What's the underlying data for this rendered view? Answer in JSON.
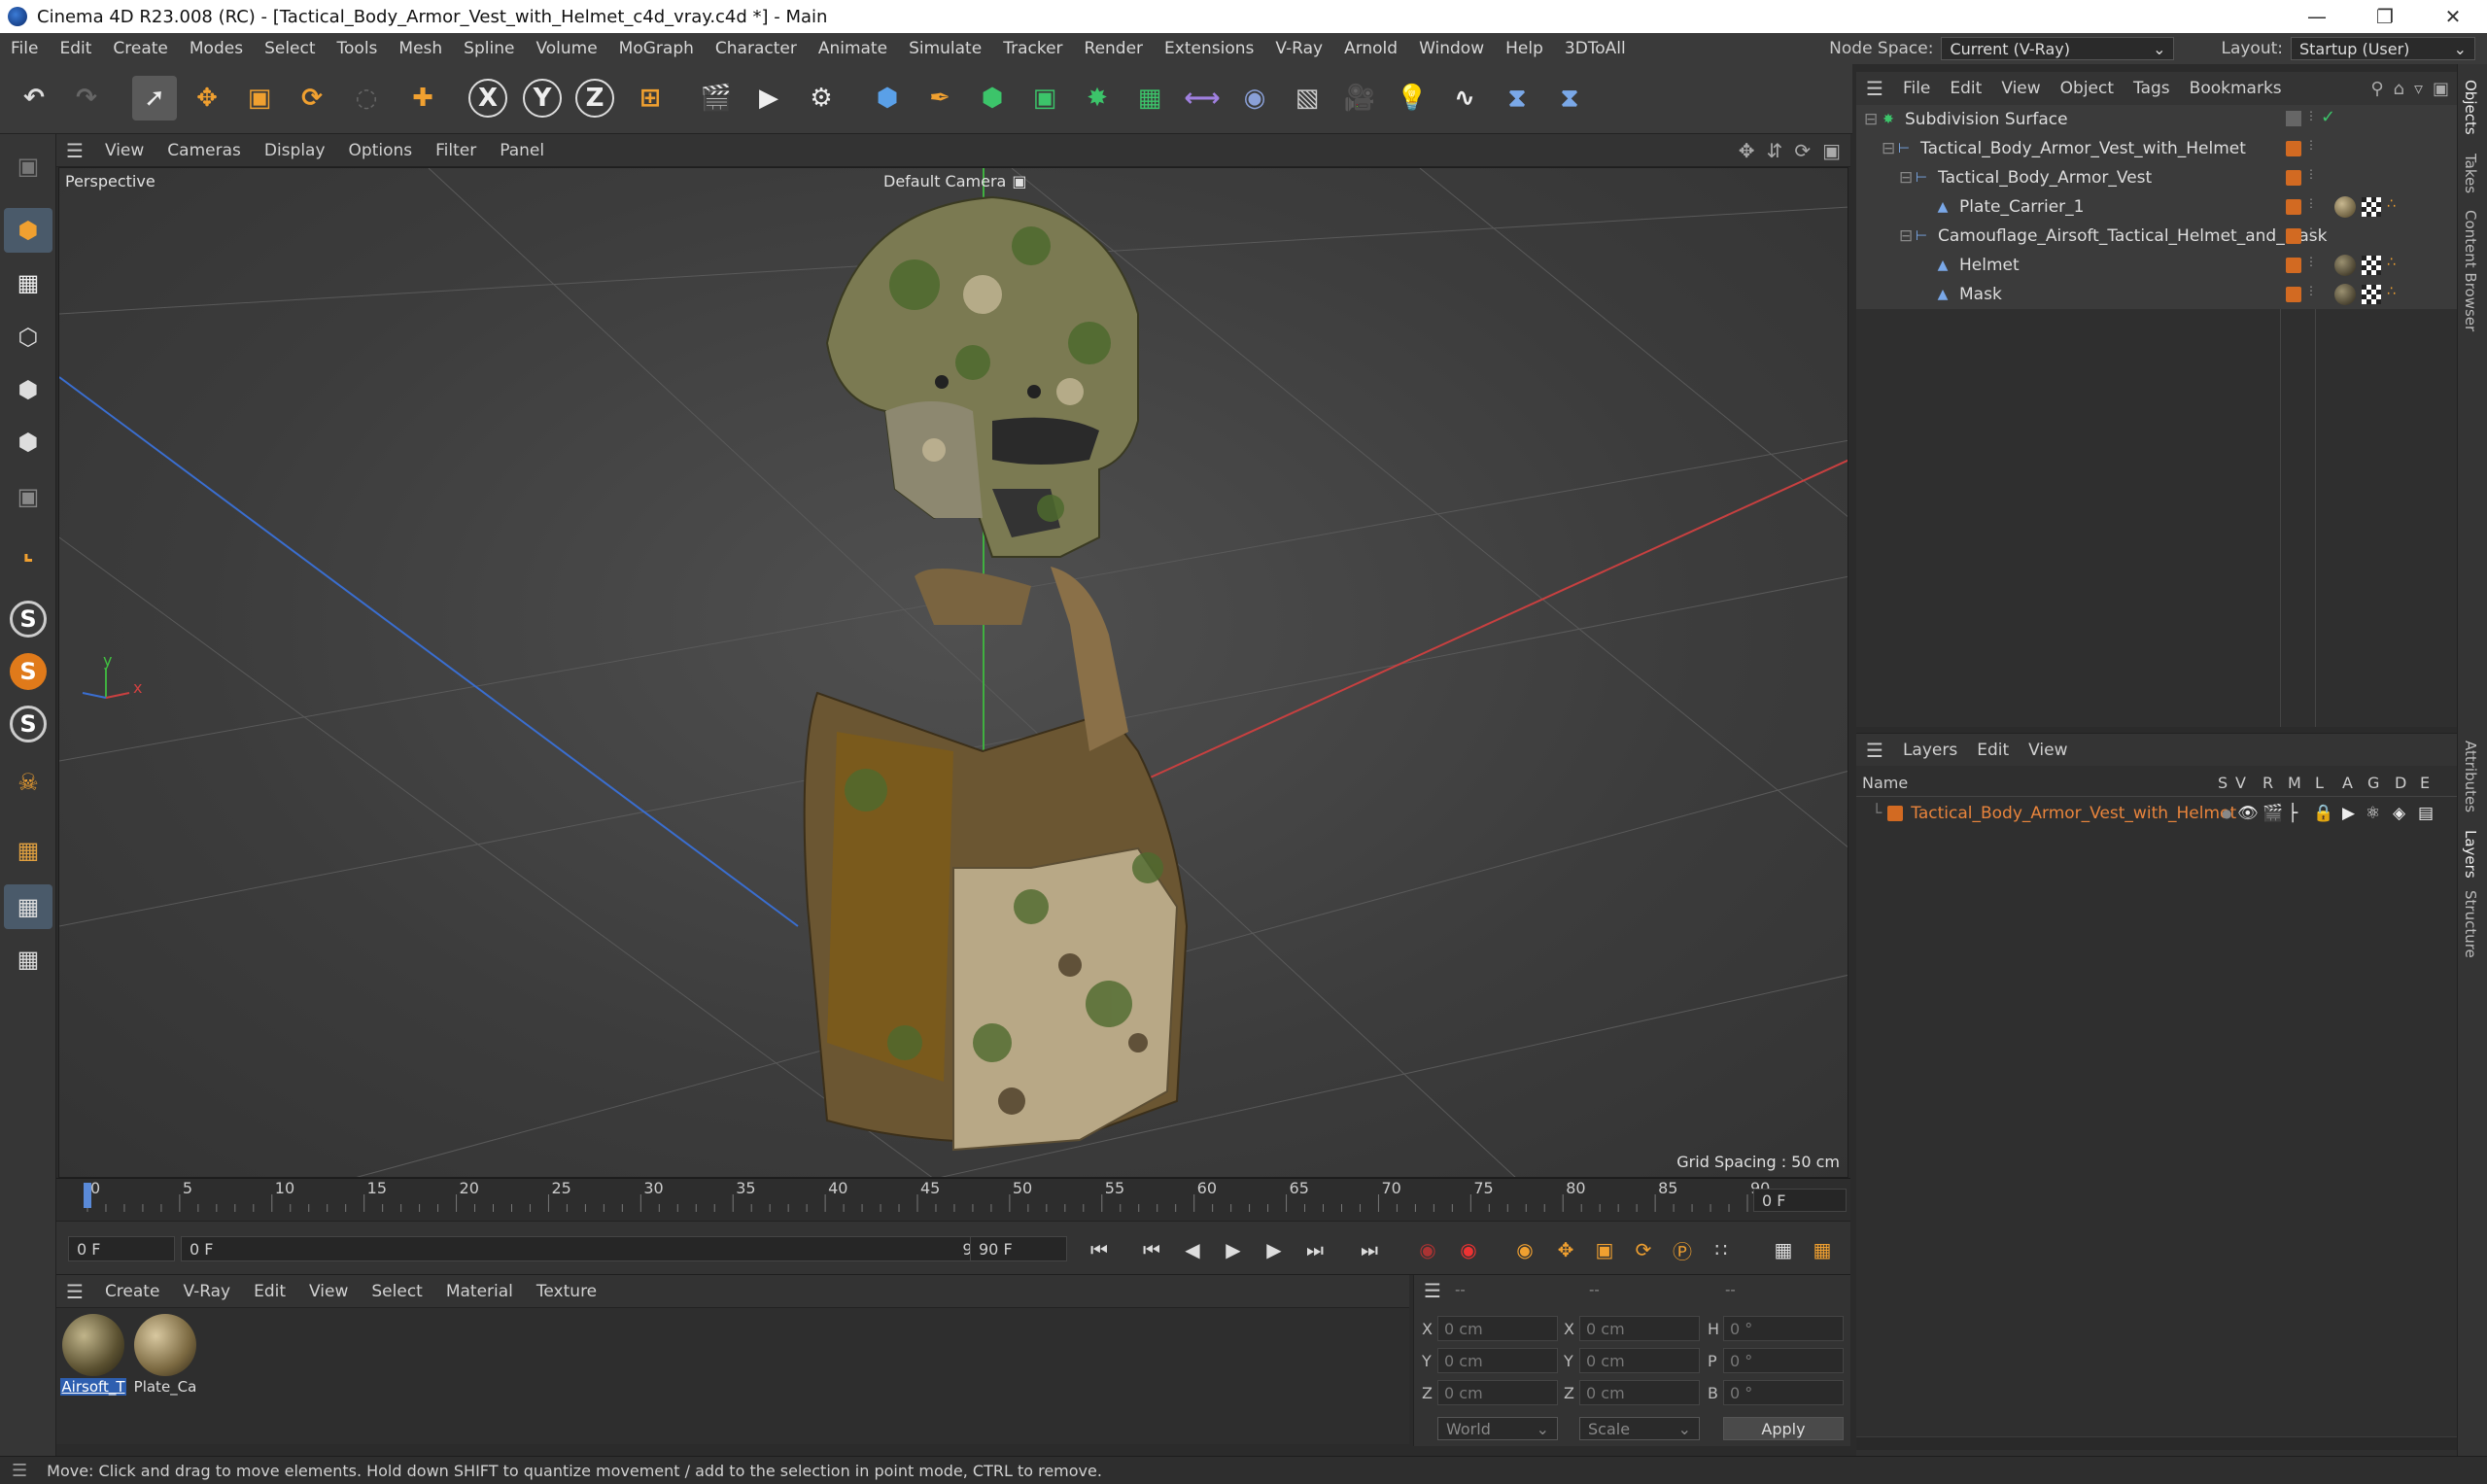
{
  "window": {
    "title": "Cinema 4D R23.008 (RC) - [Tactical_Body_Armor_Vest_with_Helmet_c4d_vray.c4d *] - Main",
    "minimize": "—",
    "maximize": "❐",
    "close": "✕"
  },
  "menubar": {
    "items": [
      "File",
      "Edit",
      "Create",
      "Modes",
      "Select",
      "Tools",
      "Mesh",
      "Spline",
      "Volume",
      "MoGraph",
      "Character",
      "Animate",
      "Simulate",
      "Tracker",
      "Render",
      "Extensions",
      "V-Ray",
      "Arnold",
      "Window",
      "Help",
      "3DToAll"
    ],
    "node_space_label": "Node Space:",
    "node_space_value": "Current (V-Ray)",
    "layout_label": "Layout:",
    "layout_value": "Startup (User)"
  },
  "viewport": {
    "menu": [
      "View",
      "Cameras",
      "Display",
      "Options",
      "Filter",
      "Panel"
    ],
    "view_name": "Perspective",
    "camera": "Default Camera",
    "grid_spacing": "Grid Spacing : 50 cm",
    "axis_y": "y",
    "axis_x": "x"
  },
  "timeline": {
    "ticks": [
      "0",
      "5",
      "10",
      "15",
      "20",
      "25",
      "30",
      "35",
      "40",
      "45",
      "50",
      "55",
      "60",
      "65",
      "70",
      "75",
      "80",
      "85",
      "90"
    ],
    "current_frame": "0 F",
    "start_frame": "0 F",
    "range_start": "0 F",
    "range_end": "90 F",
    "end_frame": "90 F"
  },
  "material_manager": {
    "menu": [
      "Create",
      "V-Ray",
      "Edit",
      "View",
      "Select",
      "Material",
      "Texture"
    ],
    "materials": [
      {
        "label": "Airsoft_T",
        "selected": true
      },
      {
        "label": "Plate_Ca",
        "selected": false
      }
    ]
  },
  "coordinates": {
    "header_left": "--",
    "header_mid": "--",
    "header_right": "--",
    "rows": [
      {
        "axis": "X",
        "pos": "0 cm",
        "axis2": "X",
        "size": "0 cm",
        "rot_axis": "H",
        "rot": "0 °"
      },
      {
        "axis": "Y",
        "pos": "0 cm",
        "axis2": "Y",
        "size": "0 cm",
        "rot_axis": "P",
        "rot": "0 °"
      },
      {
        "axis": "Z",
        "pos": "0 cm",
        "axis2": "Z",
        "size": "0 cm",
        "rot_axis": "B",
        "rot": "0 °"
      }
    ],
    "space": "World",
    "mode": "Scale",
    "apply": "Apply"
  },
  "object_manager": {
    "menu": [
      "File",
      "Edit",
      "View",
      "Object",
      "Tags",
      "Bookmarks"
    ],
    "objects": [
      {
        "name": "Subdivision Surface",
        "depth": 0
      },
      {
        "name": "Tactical_Body_Armor_Vest_with_Helmet",
        "depth": 1
      },
      {
        "name": "Tactical_Body_Armor_Vest",
        "depth": 2
      },
      {
        "name": "Plate_Carrier_1",
        "depth": 3
      },
      {
        "name": "Camouflage_Airsoft_Tactical_Helmet_and_Mask",
        "depth": 2
      },
      {
        "name": "Helmet",
        "depth": 3
      },
      {
        "name": "Mask",
        "depth": 3
      }
    ]
  },
  "layers": {
    "menu": [
      "Layers",
      "Edit",
      "View"
    ],
    "columns": [
      "Name",
      "S",
      "V",
      "R",
      "M",
      "L",
      "A",
      "G",
      "D",
      "E"
    ],
    "rows": [
      {
        "name": "Tactical_Body_Armor_Vest_with_Helmet"
      }
    ]
  },
  "side_tabs": [
    "Objects",
    "Takes",
    "Content Browser",
    "Attributes",
    "Layers",
    "Structure"
  ],
  "status": "Move: Click and drag to move elements. Hold down SHIFT to quantize movement / add to the selection in point mode, CTRL to remove.",
  "colors": {
    "accent_orange": "#d26a22",
    "layer_text": "#e8843c",
    "x_axis": "#d04040",
    "y_axis": "#40b040",
    "z_axis": "#3a6ed0"
  }
}
